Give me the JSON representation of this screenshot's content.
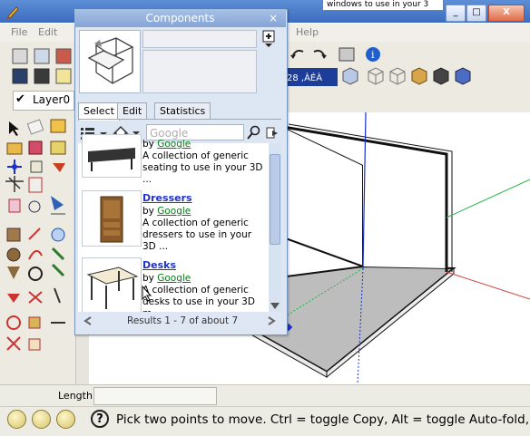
{
  "background_window": {
    "tab_text": "windows to use in your 3"
  },
  "window_buttons": {
    "minimize": "_",
    "restore": "□",
    "close": "X"
  },
  "menubar": {
    "file": "File",
    "edit": "Edit",
    "help": "Help"
  },
  "layer": {
    "value": "Layer0"
  },
  "toolbar": {
    "partial_text": "28 ,ÀÉÀ"
  },
  "components": {
    "title": "Components",
    "close": "×",
    "tabs": [
      "Select",
      "Edit",
      "Statistics"
    ],
    "search": {
      "placeholder": "Google"
    },
    "items": [
      {
        "title": "",
        "by": "by",
        "author": "Google",
        "desc": "A collection of generic seating to use in your 3D ..."
      },
      {
        "title": "Dressers",
        "by": "by",
        "author": "Google",
        "desc": "A collection of generic dressers to use in your 3D ..."
      },
      {
        "title": "Desks",
        "by": "by",
        "author": "Google",
        "desc": "A collection of generic desks to use in your 3D m..."
      }
    ],
    "results": "Results 1 - 7 of about 7"
  },
  "length": {
    "label": "Length",
    "value": ""
  },
  "status": {
    "text": "Pick two points to move.  Ctrl = toggle Copy, Alt = toggle Auto-fold, h"
  },
  "colors": {
    "title_blue": "#4a7cc8",
    "link_blue": "#1f33c9",
    "link_green": "#0a7a1a",
    "axis_blue": "#1a2fcc",
    "axis_green": "#27b34a",
    "axis_red": "#d14040"
  }
}
